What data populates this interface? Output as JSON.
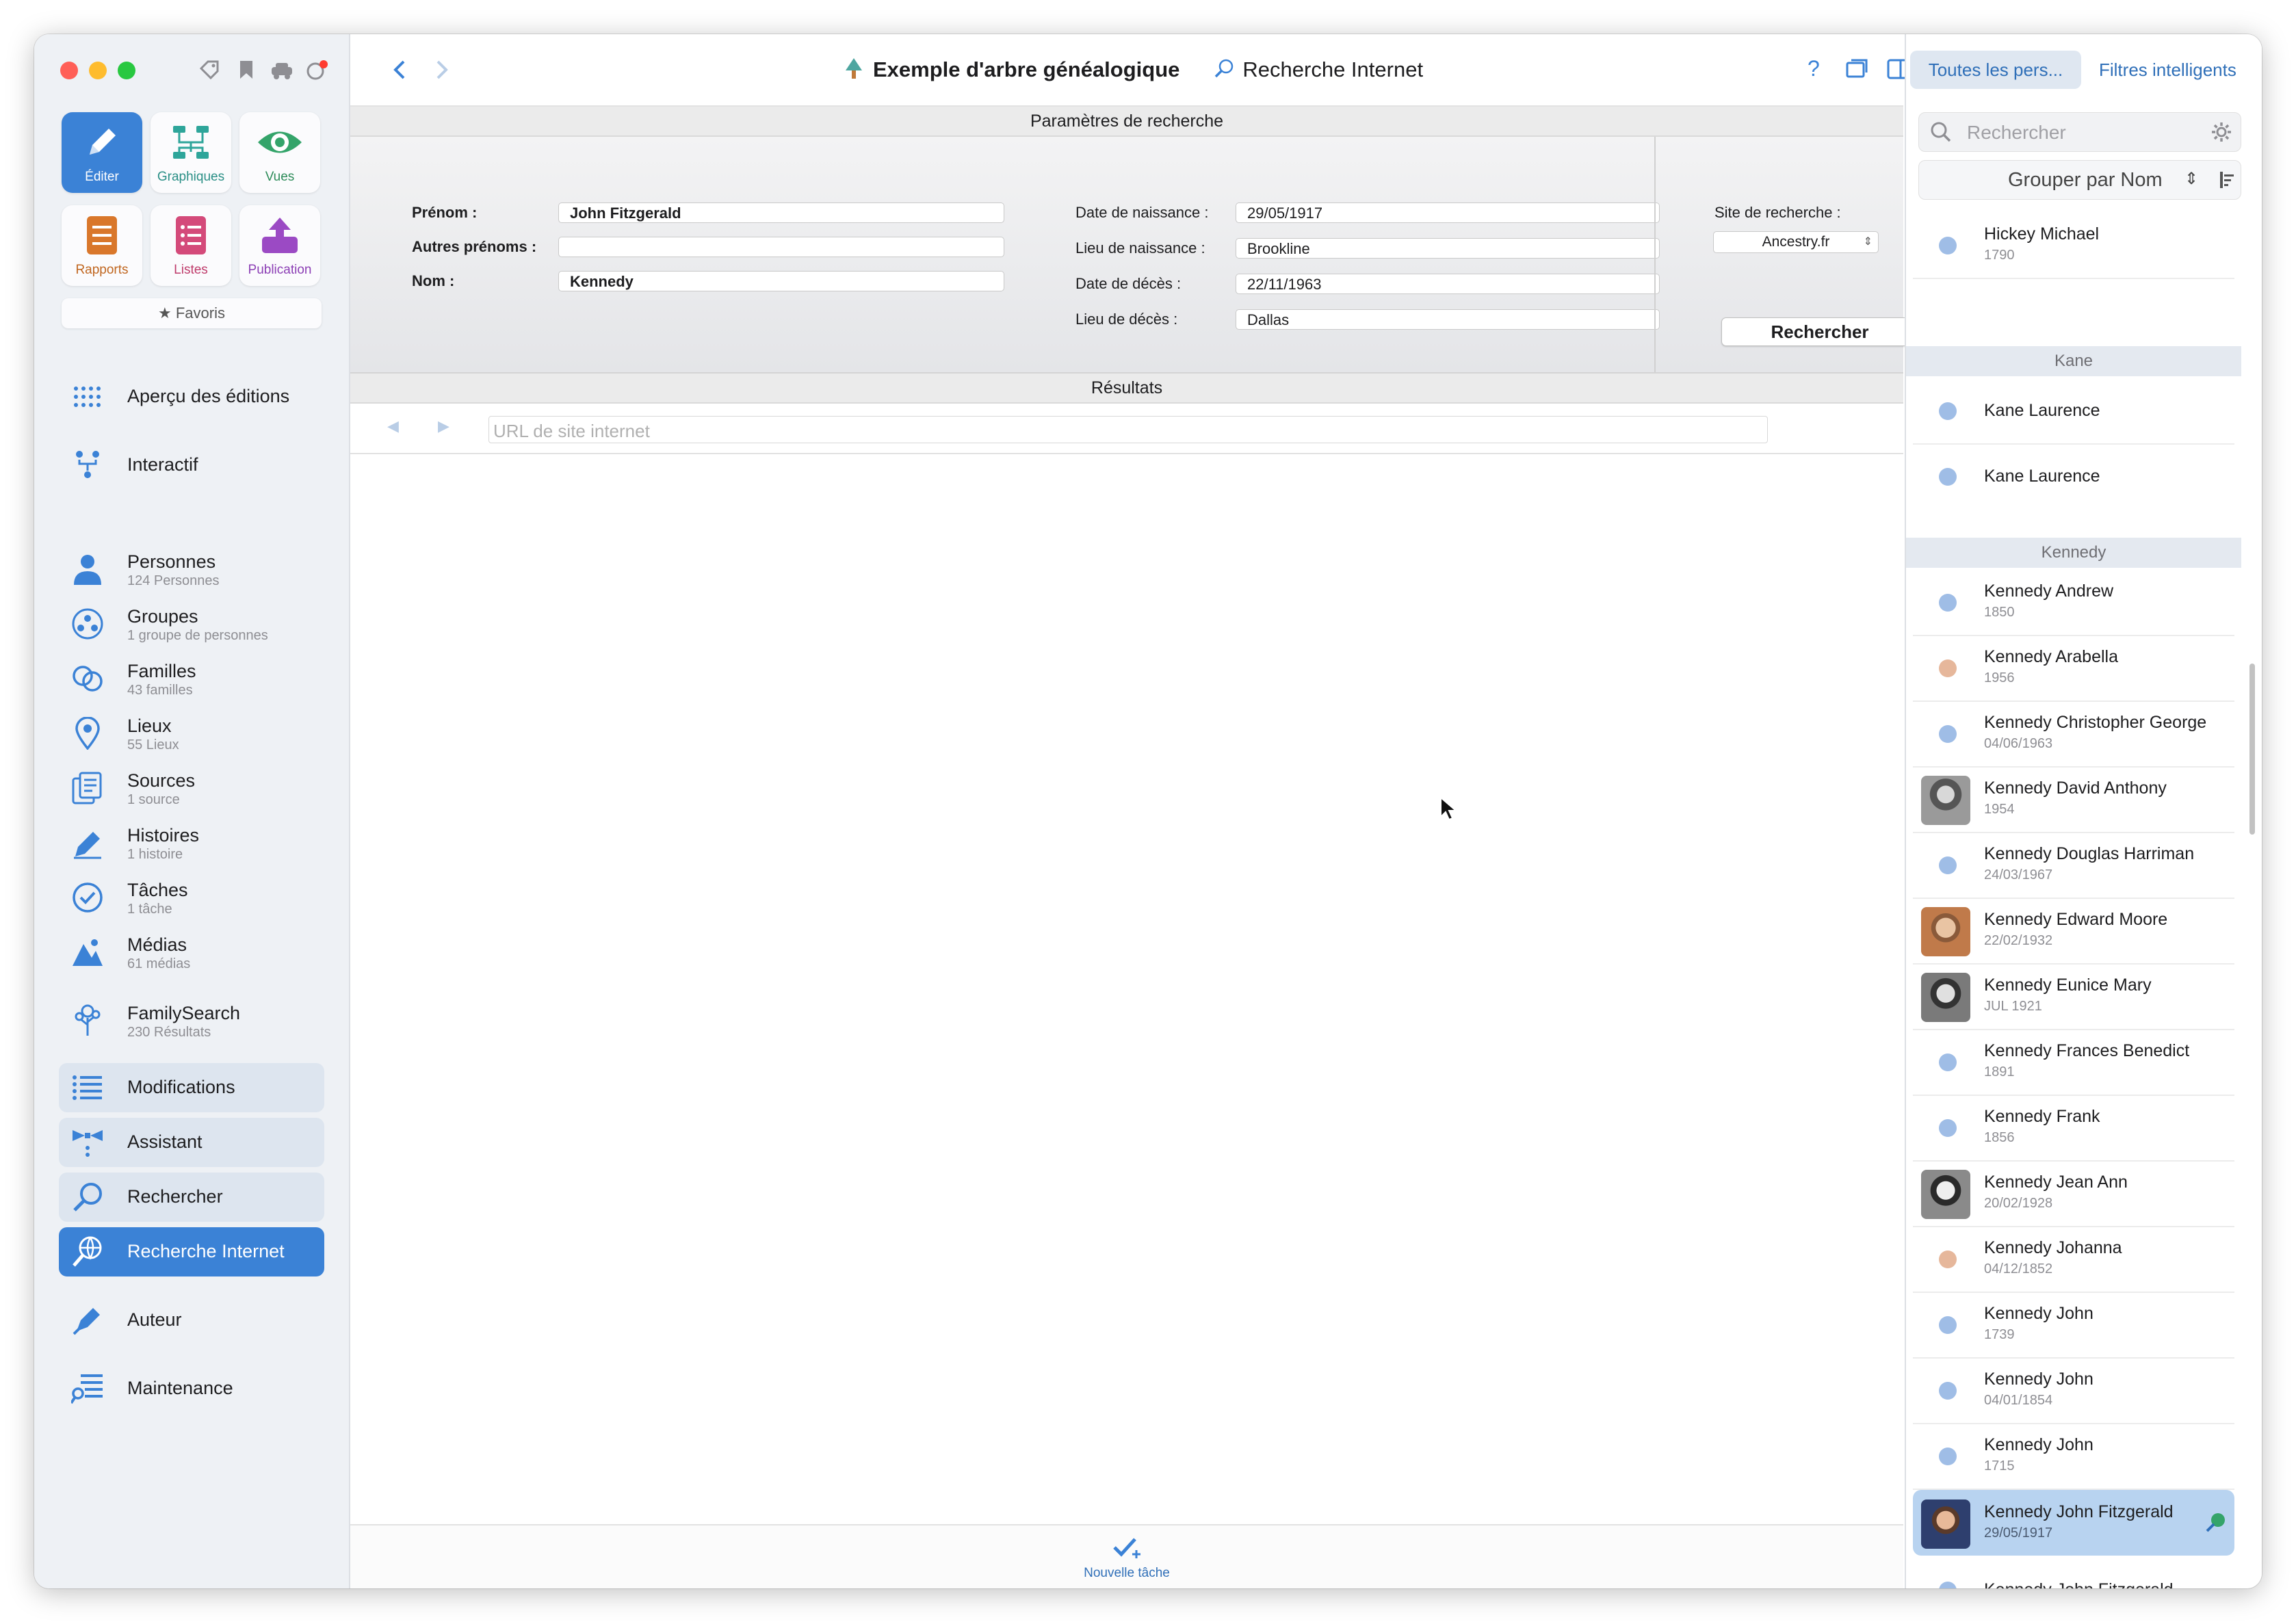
{
  "toolbar_left": {
    "tools": [
      {
        "label": "Éditer",
        "icon": "pencil-icon"
      },
      {
        "label": "Graphiques",
        "icon": "chart-tree-icon"
      },
      {
        "label": "Vues",
        "icon": "eye-icon"
      },
      {
        "label": "Rapports",
        "icon": "report-icon"
      },
      {
        "label": "Listes",
        "icon": "list-icon"
      },
      {
        "label": "Publication",
        "icon": "upload-icon"
      }
    ],
    "favorites_label": "★ Favoris"
  },
  "sidebar": {
    "items": [
      {
        "label": "Aperçu des éditions",
        "sub": ""
      },
      {
        "label": "Interactif",
        "sub": ""
      },
      {
        "label": "Personnes",
        "sub": "124 Personnes"
      },
      {
        "label": "Groupes",
        "sub": "1 groupe de personnes"
      },
      {
        "label": "Familles",
        "sub": "43 familles"
      },
      {
        "label": "Lieux",
        "sub": "55 Lieux"
      },
      {
        "label": "Sources",
        "sub": "1 source"
      },
      {
        "label": "Histoires",
        "sub": "1 histoire"
      },
      {
        "label": "Tâches",
        "sub": "1 tâche"
      },
      {
        "label": "Médias",
        "sub": "61 médias"
      },
      {
        "label": "FamilySearch",
        "sub": "230 Résultats"
      },
      {
        "label": "Modifications",
        "sub": ""
      },
      {
        "label": "Assistant",
        "sub": ""
      },
      {
        "label": "Rechercher",
        "sub": ""
      },
      {
        "label": "Recherche Internet",
        "sub": ""
      },
      {
        "label": "Auteur",
        "sub": ""
      },
      {
        "label": "Maintenance",
        "sub": ""
      }
    ]
  },
  "header": {
    "doc_title": "Exemple d'arbre généalogique",
    "view_title": "Recherche Internet"
  },
  "params": {
    "section_title": "Paramètres de recherche",
    "prenom_label": "Prénom :",
    "prenom_value": "John Fitzgerald",
    "autres_label": "Autres prénoms :",
    "autres_value": "",
    "nom_label": "Nom :",
    "nom_value": "Kennedy",
    "birth_date_label": "Date de naissance :",
    "birth_date_value": "29/05/1917",
    "birth_place_label": "Lieu de naissance :",
    "birth_place_value": "Brookline",
    "death_date_label": "Date de décès :",
    "death_date_value": "22/11/1963",
    "death_place_label": "Lieu de décès :",
    "death_place_value": "Dallas",
    "site_label": "Site de recherche :",
    "site_value": "Ancestry.fr",
    "search_button": "Rechercher"
  },
  "results": {
    "section_title": "Résultats",
    "url_placeholder": "URL de site internet"
  },
  "bottom": {
    "new_task_label": "Nouvelle tâche"
  },
  "right_panel": {
    "tab_all": "Toutes les pers...",
    "tab_smart": "Filtres intelligents",
    "search_placeholder": "Rechercher",
    "group_by": "Grouper par Nom",
    "groups": [
      "Kane",
      "Kennedy"
    ],
    "persons": [
      {
        "name": "Hickey Michael",
        "date": "1790",
        "color": "#9fbde6"
      },
      {
        "name": "Kane Laurence",
        "date": "",
        "color": "#9fbde6"
      },
      {
        "name": "Kane Laurence",
        "date": "",
        "color": "#9fbde6"
      },
      {
        "name": "Kennedy Andrew",
        "date": "1850",
        "color": "#9fbde6"
      },
      {
        "name": "Kennedy Arabella",
        "date": "1956",
        "color": "#e6b79b"
      },
      {
        "name": "Kennedy Christopher George",
        "date": "04/06/1963",
        "color": "#9fbde6"
      },
      {
        "name": "Kennedy David Anthony",
        "date": "1954",
        "color": "photo"
      },
      {
        "name": "Kennedy Douglas Harriman",
        "date": "24/03/1967",
        "color": "#9fbde6"
      },
      {
        "name": "Kennedy Edward Moore",
        "date": "22/02/1932",
        "color": "photo"
      },
      {
        "name": "Kennedy Eunice Mary",
        "date": "JUL 1921",
        "color": "photo"
      },
      {
        "name": "Kennedy Frances Benedict",
        "date": "1891",
        "color": "#9fbde6"
      },
      {
        "name": "Kennedy Frank",
        "date": "1856",
        "color": "#9fbde6"
      },
      {
        "name": "Kennedy Jean Ann",
        "date": "20/02/1928",
        "color": "photo"
      },
      {
        "name": "Kennedy Johanna",
        "date": "04/12/1852",
        "color": "#e6b79b"
      },
      {
        "name": "Kennedy John",
        "date": "1739",
        "color": "#9fbde6"
      },
      {
        "name": "Kennedy John",
        "date": "04/01/1854",
        "color": "#9fbde6"
      },
      {
        "name": "Kennedy John",
        "date": "1715",
        "color": "#9fbde6"
      },
      {
        "name": "Kennedy John Fitzgerald",
        "date": "29/05/1917",
        "color": "photo"
      },
      {
        "name": "Kennedy John Fitzgerald",
        "date": "",
        "color": "#9fbde6"
      }
    ]
  },
  "colors": {
    "accent": "#3b82d6",
    "close": "#ff5f57",
    "minimize": "#febc2e",
    "zoom": "#28c840"
  }
}
